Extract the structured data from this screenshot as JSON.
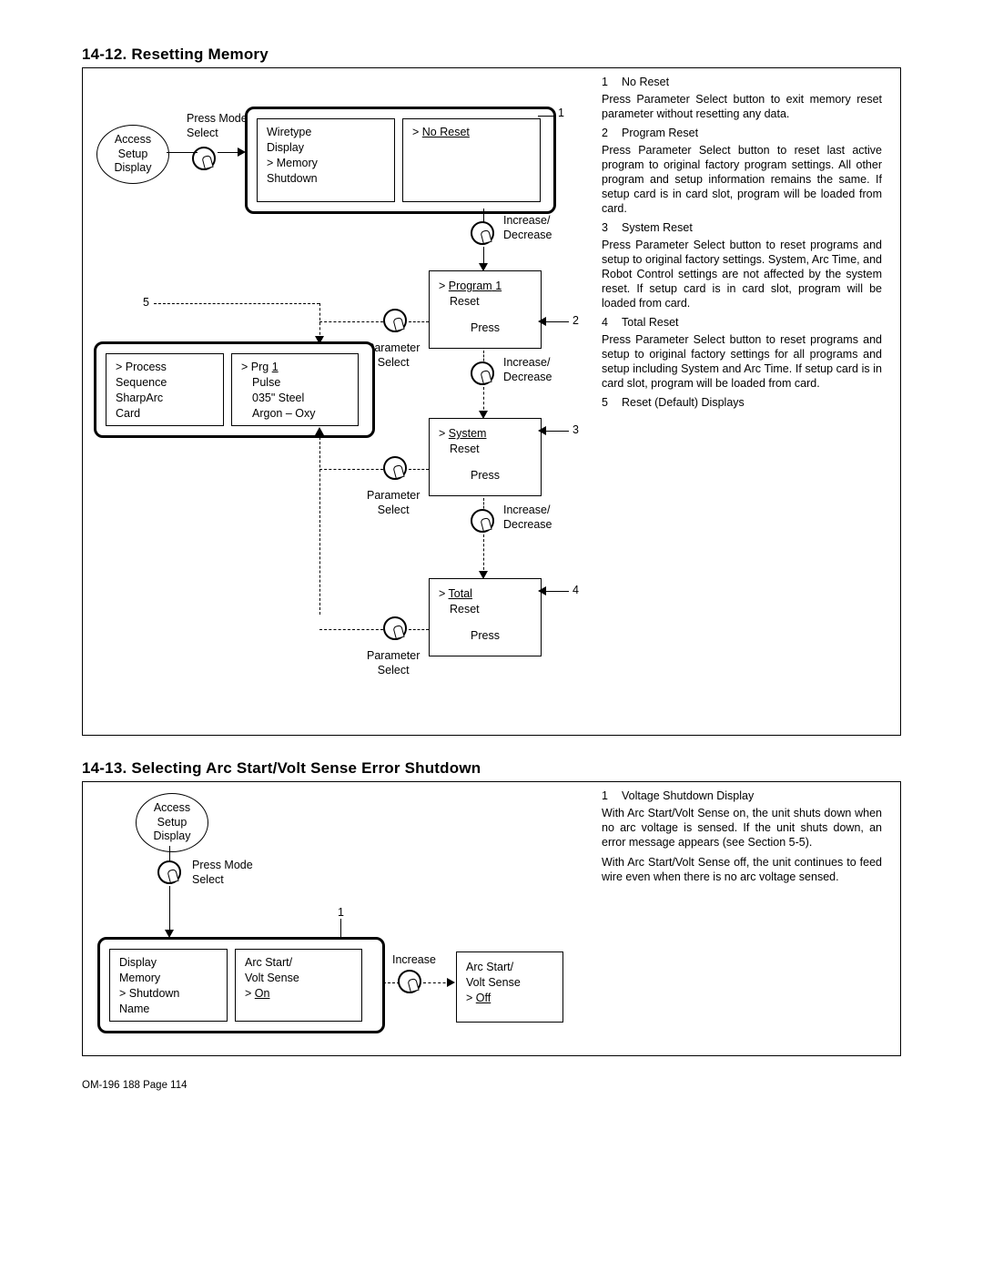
{
  "section12": {
    "title": "14-12.  Resetting Memory",
    "oval_access": "Access\nSetup\nDisplay",
    "press_mode_select": "Press Mode\nSelect",
    "thick_top_left": "Wiretype\nDisplay\n> Memory\n   Shutdown",
    "thick_top_right_line1": "> ",
    "thick_top_right_underline": "No Reset",
    "callout_1": "1",
    "incdec": "Increase/\nDecrease",
    "box_program_line1_prefix": "> ",
    "box_program_line1_u": "Program",
    "box_program_line1_suffix": " 1",
    "box_program_line2": "Reset",
    "box_program_press": "Press",
    "callout_2": "2",
    "param_select": "Parameter\nSelect",
    "callout_5": "5",
    "thick5_left": "> Process\n   Sequence\n   SharpArc\n   Card",
    "thick5_right_line1_prefix": "> Prg  ",
    "thick5_right_line1_u": "1",
    "thick5_right_rest": "Pulse\n035\" Steel\nArgon – Oxy",
    "box_system_line1_prefix": "> ",
    "box_system_line1_u": "System",
    "box_system_line2": "Reset",
    "box_system_press": "Press",
    "callout_3": "3",
    "box_total_line1_prefix": "> ",
    "box_total_line1_u": "Total",
    "box_total_line2": "Reset",
    "box_total_press": "Press",
    "callout_4": "4",
    "defs": [
      {
        "n": "1",
        "t": "No Reset"
      },
      {
        "b": "Press Parameter Select button to exit memory reset parameter without resetting any data."
      },
      {
        "n": "2",
        "t": "Program Reset"
      },
      {
        "b": "Press Parameter Select button to reset last active program to original factory program settings. All other program and setup information remains the same. If setup card is in card slot, program will be loaded from card."
      },
      {
        "n": "3",
        "t": "System Reset"
      },
      {
        "b": "Press Parameter Select button to reset programs and setup to original factory settings. System, Arc Time, and Robot Control settings are not affected by the system reset.  If setup card is in card slot, program will be loaded from card."
      },
      {
        "n": "4",
        "t": "Total Reset"
      },
      {
        "b": "Press Parameter Select button to reset programs and setup to original factory settings for all programs and setup including System and Arc Time. If setup card is in card slot, program will be loaded from card."
      },
      {
        "n": "5",
        "t": "Reset (Default) Displays"
      }
    ]
  },
  "section13": {
    "title": "14-13.  Selecting Arc Start/Volt Sense Error Shutdown",
    "oval_access": "Access\nSetup\nDisplay",
    "press_mode_select": "Press Mode\nSelect",
    "callout_1": "1",
    "thick_left": "   Display\n   Memory\n> Shutdown\n   Name",
    "thick_right": "Arc Start/\nVolt Sense\n> ",
    "thick_right_u": "On",
    "increase": "Increase",
    "box_off": "Arc Start/\nVolt Sense\n> ",
    "box_off_u": "Off",
    "defs": [
      {
        "n": "1",
        "t": "Voltage Shutdown Display"
      },
      {
        "b": "With Arc Start/Volt Sense on, the unit shuts down when no arc voltage is sensed. If the unit shuts down, an error message appears (see Section 5-5)."
      },
      {
        "b": "With Arc Start/Volt Sense off, the unit continues to feed wire even when there is no arc voltage sensed."
      }
    ]
  },
  "footer": "OM-196 188 Page 114"
}
